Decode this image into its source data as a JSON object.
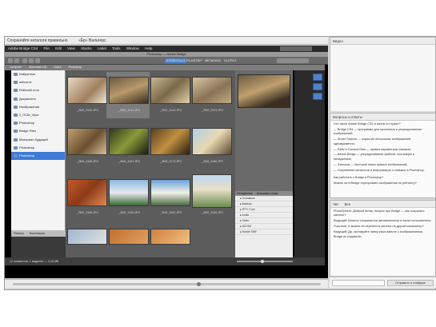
{
  "webinar": {
    "title": "Сохраняйте каталоги правильно",
    "subtitle": "«Ёр» Вальтерс",
    "footer_text": ""
  },
  "bridge": {
    "mac_menu": [
      "Adobe Bridge CS4",
      "File",
      "Edit",
      "View",
      "Stacks",
      "Label",
      "Tools",
      "Window",
      "Help"
    ],
    "window_title": "Photoshop — Adobe Bridge",
    "toolbar_tabs": [
      "ESSENTIALS",
      "FILMSTRIP",
      "METADATA",
      "OUTPUT"
    ],
    "path": [
      "Computer",
      "Macintosh HD",
      "Users",
      "Photoshop"
    ],
    "sidebar_items": [
      {
        "label": "Избранное"
      },
      {
        "label": "welcome"
      },
      {
        "label": "Рабочий стол"
      },
      {
        "label": "Документы"
      },
      {
        "label": "Изображения"
      },
      {
        "label": "2_ПСМ_Урок"
      },
      {
        "label": "Photoshop"
      },
      {
        "label": "Bridge Files"
      },
      {
        "label": "Материал будущей"
      },
      {
        "label": "Photoshop"
      },
      {
        "label": "Photoshop"
      }
    ],
    "sidebar_tabs": [
      "Фильтр",
      "Коллекции"
    ],
    "thumb_captions": [
      "_2MG_3120.JPG",
      "_2MG_3141.JPG",
      "_2MG_3143.JPG",
      "_2MG_3151.JPG",
      "_2MG_3166.JPG",
      "_2MG_3167.JPG",
      "_2MG_3173.JPG",
      "_2MG_3180.JPG",
      "_2MG_3186.JPG",
      "_2MG_3190.JPG",
      "_2MG_3192.JPG",
      "_2MG_3195.JPG"
    ],
    "meta_tabs": [
      "Метаданные",
      "Ключевые слова"
    ],
    "meta_rows": [
      "▸ Основные",
      "▸ Камера",
      "▸ IPTC Core",
      "▸ Audio",
      "▸ Video",
      "▸ DICOM",
      "▸ Mobile SWF"
    ],
    "status_text": "12 элементов, 1 выделен — 3,16 МБ",
    "thumb_size_fraction": 0.45
  },
  "right": {
    "notes_title": "Видео",
    "questions_title": "Вопросы и ответы",
    "questions_body": [
      "Что такое Adobe Bridge CS4 и зачем он нужен?",
      "— Bridge CS4 — программа для просмотра и упорядочивания изображений;",
      "— Smart Objects — открытие нескольких изображений одновременно;",
      "— RAW и Camera Raw — правка параметров снимков;",
      "— Adobe Bridge — упорядочивание файлов, коллекции и метаданные;",
      "— Фильтры — быстрый поиск нужных изображений;",
      "— Сохранение каталогов и информации о снимках в Photoshop."
    ],
    "q1": "Как работать с Bridge в Photoshop?",
    "q2": "Можно ли в Bridge сортировать изображения по рейтингу?",
    "chat_title": "Чат",
    "chat_tab": "Все",
    "chat_lines": [
      "PhotoSphere: Добрый вечер, вопрос про Bridge — как сохранить каталог?",
      "Ведущий: Каталог сохраняется автоматически в папке пользователя.",
      "Участник: А можно ли перенести каталог на другой компьютер?",
      "Ведущий: Да, скопируйте папку кэша вместе с изображениями, Bridge их подхватит."
    ],
    "send_label": "Отправить в слайдере"
  },
  "colors": {
    "accent": "#3d7bd6",
    "toolbar_active": "#4f82c8",
    "canvas_bg": "#000000"
  }
}
